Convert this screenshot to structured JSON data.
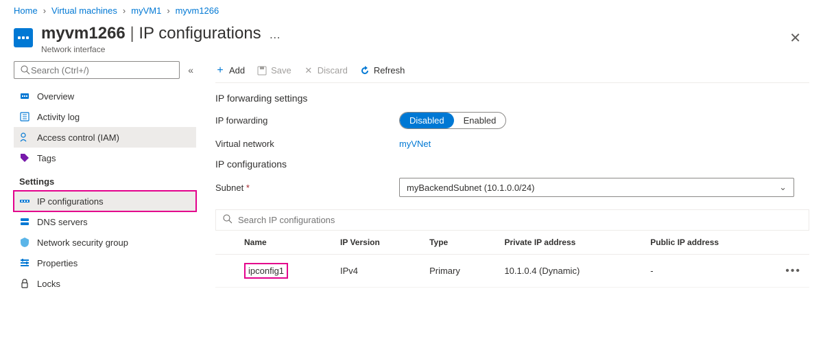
{
  "breadcrumb": [
    {
      "label": "Home"
    },
    {
      "label": "Virtual machines"
    },
    {
      "label": "myVM1"
    },
    {
      "label": "myvm1266"
    }
  ],
  "header": {
    "resource_name": "myvm1266",
    "page_title": "IP configurations",
    "subtitle": "Network interface"
  },
  "sidebar": {
    "search_placeholder": "Search (Ctrl+/)",
    "items_top": [
      {
        "label": "Overview"
      },
      {
        "label": "Activity log"
      },
      {
        "label": "Access control (IAM)"
      },
      {
        "label": "Tags"
      }
    ],
    "section_settings_label": "Settings",
    "items_settings": [
      {
        "label": "IP configurations"
      },
      {
        "label": "DNS servers"
      },
      {
        "label": "Network security group"
      },
      {
        "label": "Properties"
      },
      {
        "label": "Locks"
      }
    ]
  },
  "toolbar": {
    "add": "Add",
    "save": "Save",
    "discard": "Discard",
    "refresh": "Refresh"
  },
  "forwarding": {
    "section_title": "IP forwarding settings",
    "ipfwd_label": "IP forwarding",
    "toggle_disabled": "Disabled",
    "toggle_enabled": "Enabled",
    "vnet_label": "Virtual network",
    "vnet_value": "myVNet"
  },
  "ipconfigs": {
    "section_title": "IP configurations",
    "subnet_label": "Subnet",
    "subnet_value": "myBackendSubnet (10.1.0.0/24)",
    "search_placeholder": "Search IP configurations",
    "columns": {
      "name": "Name",
      "ipversion": "IP Version",
      "type": "Type",
      "private": "Private IP address",
      "public": "Public IP address"
    },
    "rows": [
      {
        "name": "ipconfig1",
        "ipversion": "IPv4",
        "type": "Primary",
        "private": "10.1.0.4 (Dynamic)",
        "public": "-"
      }
    ]
  }
}
